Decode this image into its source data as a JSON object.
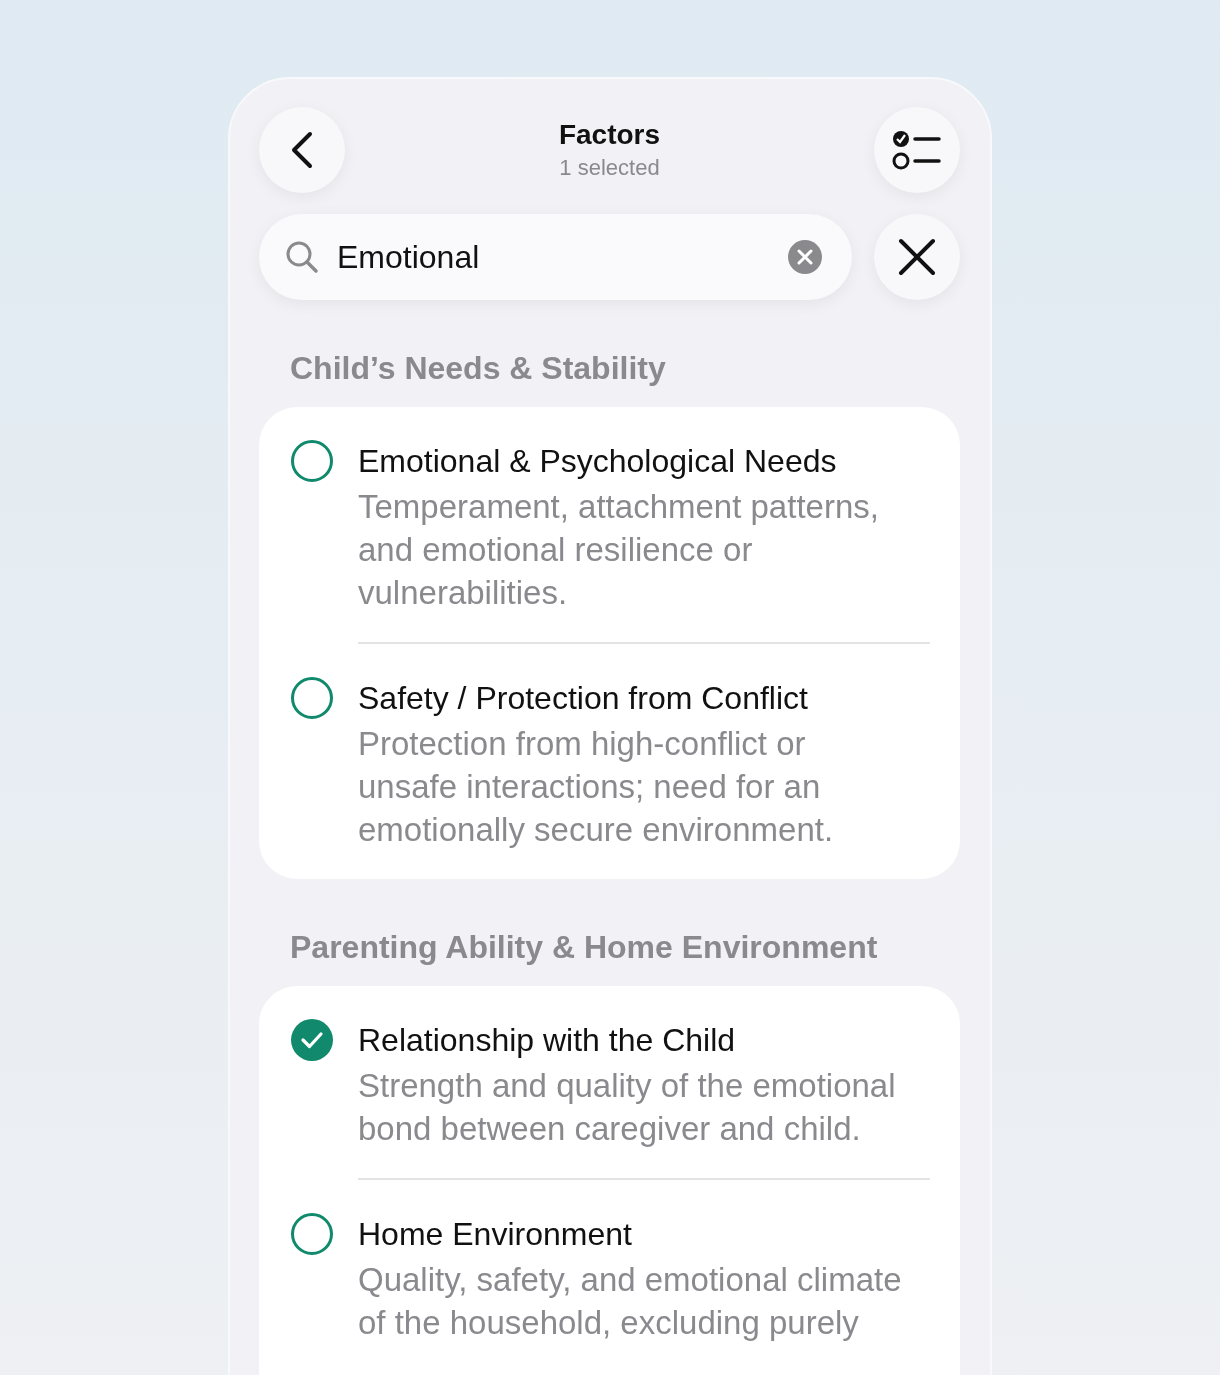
{
  "header": {
    "title": "Factors",
    "subtitle": "1 selected"
  },
  "search": {
    "value": "Emotional"
  },
  "sections": [
    {
      "title": "Child’s Needs & Stability",
      "items": [
        {
          "title": "Emotional & Psychological Needs",
          "description": "Temperament, attachment patterns, and emotional resilience or vulnerabilities.",
          "selected": false
        },
        {
          "title": "Safety / Protection from Conflict",
          "description": "Protection from high-conflict or unsafe interactions; need for an emotionally secure environment.",
          "selected": false
        }
      ]
    },
    {
      "title": "Parenting Ability & Home Environment",
      "items": [
        {
          "title": "Relationship with the Child",
          "description": "Strength and quality of the emotional bond between caregiver and child.",
          "selected": true
        },
        {
          "title": "Home Environment",
          "description": "Quality, safety, and emotional climate of the household, excluding purely",
          "selected": false
        }
      ]
    }
  ]
}
